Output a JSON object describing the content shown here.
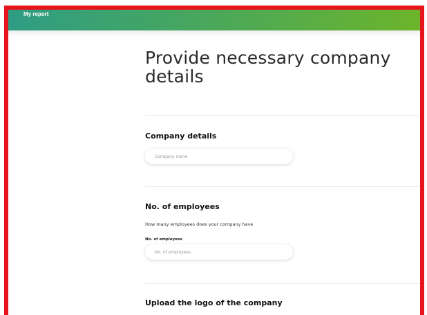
{
  "header": {
    "title": "My report",
    "gradient_start": "#2f9d84",
    "gradient_end": "#6cb42a",
    "frame_color": "#e8141c"
  },
  "page": {
    "title": "Provide necessary company details"
  },
  "company_details": {
    "title": "Company details",
    "company_name_placeholder": "Company name",
    "company_name_value": ""
  },
  "employees": {
    "title": "No. of employees",
    "helper": "How many employees does your company have",
    "field_label": "No. of employees",
    "field_placeholder": "No. of employees",
    "field_value": ""
  },
  "logo": {
    "title": "Upload the logo of the company"
  }
}
